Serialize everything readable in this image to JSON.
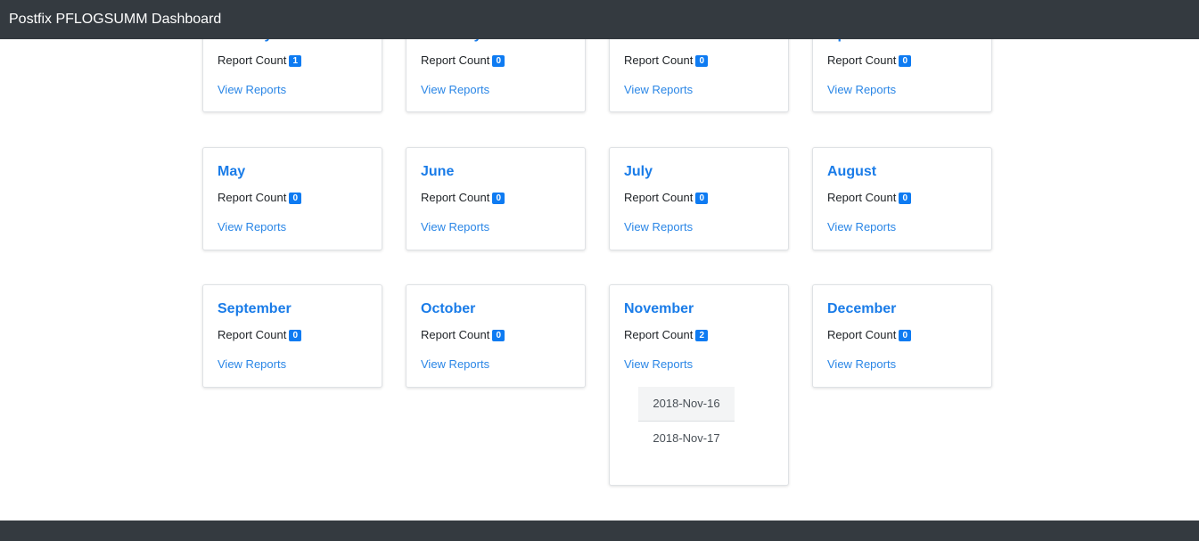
{
  "app": {
    "title": "Postfix PFLOGSUMM Dashboard"
  },
  "months": [
    {
      "name": "January",
      "count_label": "Report Count",
      "count": "1",
      "link": "View Reports"
    },
    {
      "name": "February",
      "count_label": "Report Count",
      "count": "0",
      "link": "View Reports"
    },
    {
      "name": "March",
      "count_label": "Report Count",
      "count": "0",
      "link": "View Reports"
    },
    {
      "name": "April",
      "count_label": "Report Count",
      "count": "0",
      "link": "View Reports"
    },
    {
      "name": "May",
      "count_label": "Report Count",
      "count": "0",
      "link": "View Reports"
    },
    {
      "name": "June",
      "count_label": "Report Count",
      "count": "0",
      "link": "View Reports"
    },
    {
      "name": "July",
      "count_label": "Report Count",
      "count": "0",
      "link": "View Reports"
    },
    {
      "name": "August",
      "count_label": "Report Count",
      "count": "0",
      "link": "View Reports"
    },
    {
      "name": "September",
      "count_label": "Report Count",
      "count": "0",
      "link": "View Reports"
    },
    {
      "name": "October",
      "count_label": "Report Count",
      "count": "0",
      "link": "View Reports"
    },
    {
      "name": "November",
      "count_label": "Report Count",
      "count": "2",
      "link": "View Reports",
      "reports": [
        "2018-Nov-16",
        "2018-Nov-17"
      ]
    },
    {
      "name": "December",
      "count_label": "Report Count",
      "count": "0",
      "link": "View Reports"
    }
  ],
  "colors": {
    "navbar": "#343a40",
    "title": "#1a7ce8",
    "badge": "#0e7bf2",
    "link": "#2a86e6"
  }
}
